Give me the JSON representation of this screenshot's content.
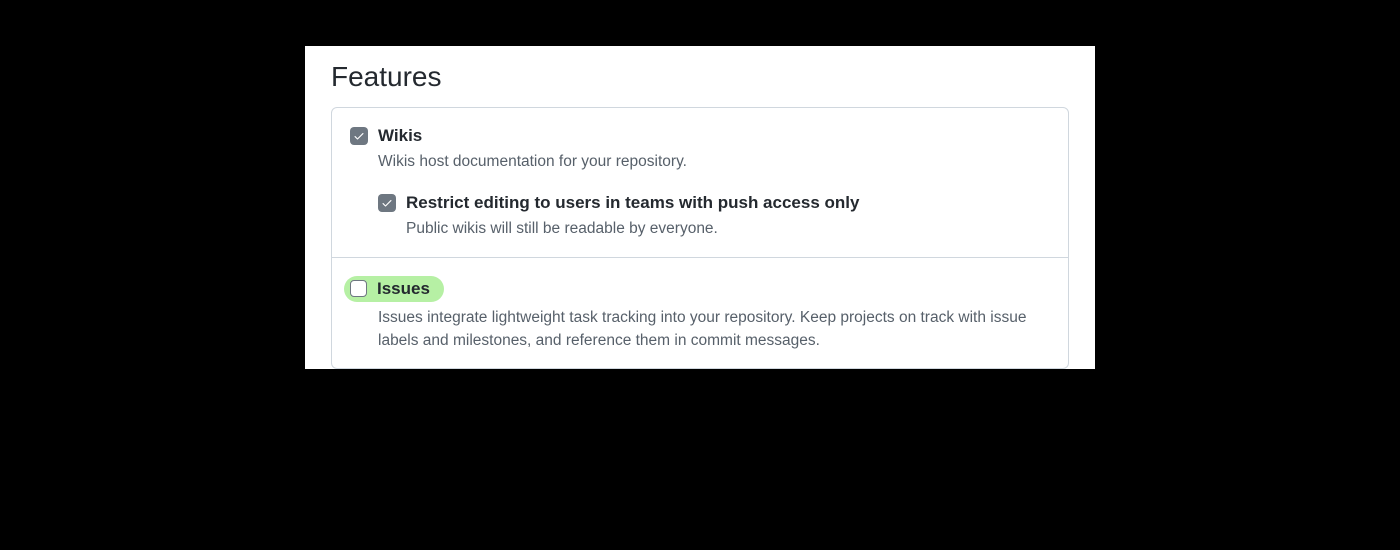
{
  "section_title": "Features",
  "wikis": {
    "label": "Wikis",
    "desc": "Wikis host documentation for your repository.",
    "checked": true,
    "sub": {
      "label": "Restrict editing to users in teams with push access only",
      "desc": "Public wikis will still be readable by everyone.",
      "checked": true
    }
  },
  "issues": {
    "label": "Issues",
    "desc": "Issues integrate lightweight task tracking into your repository. Keep projects on track with issue labels and milestones, and reference them in commit messages.",
    "checked": false
  }
}
